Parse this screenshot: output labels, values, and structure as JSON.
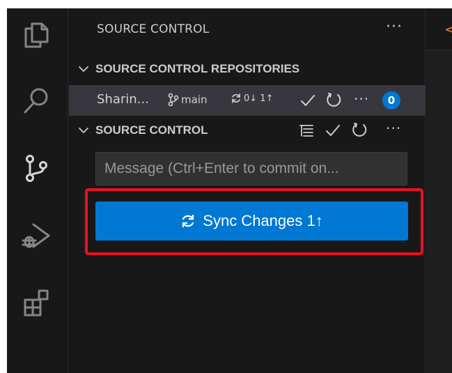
{
  "sidebar": {
    "title": "SOURCE CONTROL",
    "more": "···"
  },
  "repositories": {
    "header": "SOURCE CONTROL REPOSITORIES",
    "repo": {
      "name": "Sharin...",
      "branch": "main",
      "sync_status": "0↓ 1↑",
      "badge": "0"
    }
  },
  "source_control": {
    "header": "SOURCE CONTROL",
    "message_placeholder": "Message (Ctrl+Enter to commit on...",
    "sync_button_label": "Sync Changes 1↑"
  },
  "editor": {
    "tab_glyph": "<"
  },
  "colors": {
    "accent": "#0078d4",
    "highlight": "#e81123",
    "background": "#181818"
  }
}
